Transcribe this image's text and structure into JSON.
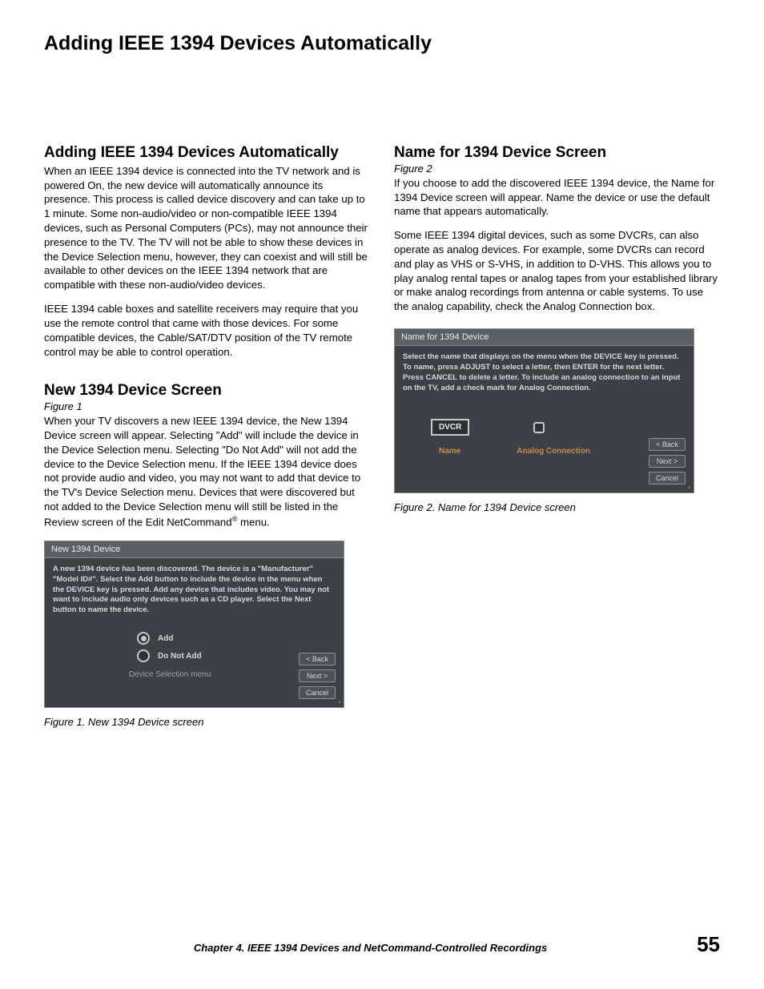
{
  "pageTitle": "Adding IEEE 1394 Devices Automatically",
  "left": {
    "sec1": {
      "head": "Adding IEEE 1394 Devices Automatically",
      "p1": "When an IEEE 1394 device is connected into the TV network and is powered On, the new device will automatically announce its presence.  This process is called device discovery and can take up to 1 minute.  Some non-audio/video or non-compatible IEEE 1394 devices, such as Personal Computers (PCs), may not announce their presence to the TV.  The TV will not be able to show these devices in the Device Selection menu, however, they can coexist and will still be available to other devices on the IEEE 1394 network that are compatible with these non-audio/video devices.",
      "p2": "IEEE 1394 cable boxes and satellite receivers may require that you use the remote control that came with those devices.  For some compatible devices, the Cable/SAT/DTV position of the TV remote control may be able to control operation."
    },
    "sec2": {
      "head": "New 1394 Device Screen",
      "figref": "Figure 1",
      "p1a": "When your TV discovers a new IEEE 1394 device, the New 1394 Device screen will appear.  Selecting \"Add\" will include the device in the Device Selection menu.  Selecting \"Do Not Add\" will not add the device to the Device Selection menu.  If the IEEE 1394 device does not provide audio and video, you may not want to add that device to the TV's Device Selection menu.  Devices that were discovered but not added to the Device Selection menu will still be listed in the Review screen of the Edit NetCommand",
      "p1b": " menu."
    },
    "fig1": {
      "title": "New 1394 Device",
      "instr": "A new 1394 device has been discovered. The device is a \"Manufacturer\" \"Model ID#\".  Select the Add button to include the device in the menu when the DEVICE key is pressed.   Add any device that includes video.  You may not want to include audio only devices such as a CD player.  Select the Next button to name the device.",
      "optAdd": "Add",
      "optNoAdd": "Do Not Add",
      "dsel": "Device Selection menu",
      "back": "< Back",
      "next": "Next >",
      "cancel": "Cancel",
      "caption": "Figure 1. New 1394 Device screen"
    }
  },
  "right": {
    "sec1": {
      "head": "Name for 1394 Device Screen",
      "figref": "Figure 2",
      "p1": "If you choose to add the discovered IEEE 1394 device, the Name for 1394 Device screen will appear.  Name the device or use the default name that appears automatically.",
      "p2": "Some IEEE 1394 digital devices, such as some DVCRs, can also operate as analog devices.  For example, some DVCRs can record and play as VHS or S-VHS, in addition to D-VHS.  This allows you to play analog rental tapes or analog tapes from your established library or make analog recordings from antenna or cable systems.  To use the analog capability, check the Analog Connection box."
    },
    "fig2": {
      "title": "Name for 1394 Device",
      "instr": "Select the name that displays on the menu when the DEVICE key is pressed.  To name, press ADJUST to select a letter, then ENTER for the next letter. Press CANCEL to delete a letter. To include an analog connection to an input on the TV, add a check mark for Analog Connection.",
      "nameVal": "DVCR",
      "lblName": "Name",
      "lblAnalog": "Analog Connection",
      "back": "< Back",
      "next": "Next >",
      "cancel": "Cancel",
      "caption": "Figure 2. Name for 1394 Device screen"
    }
  },
  "footer": {
    "chapter": "Chapter 4. IEEE 1394 Devices and NetCommand-Controlled Recordings",
    "page": "55"
  }
}
